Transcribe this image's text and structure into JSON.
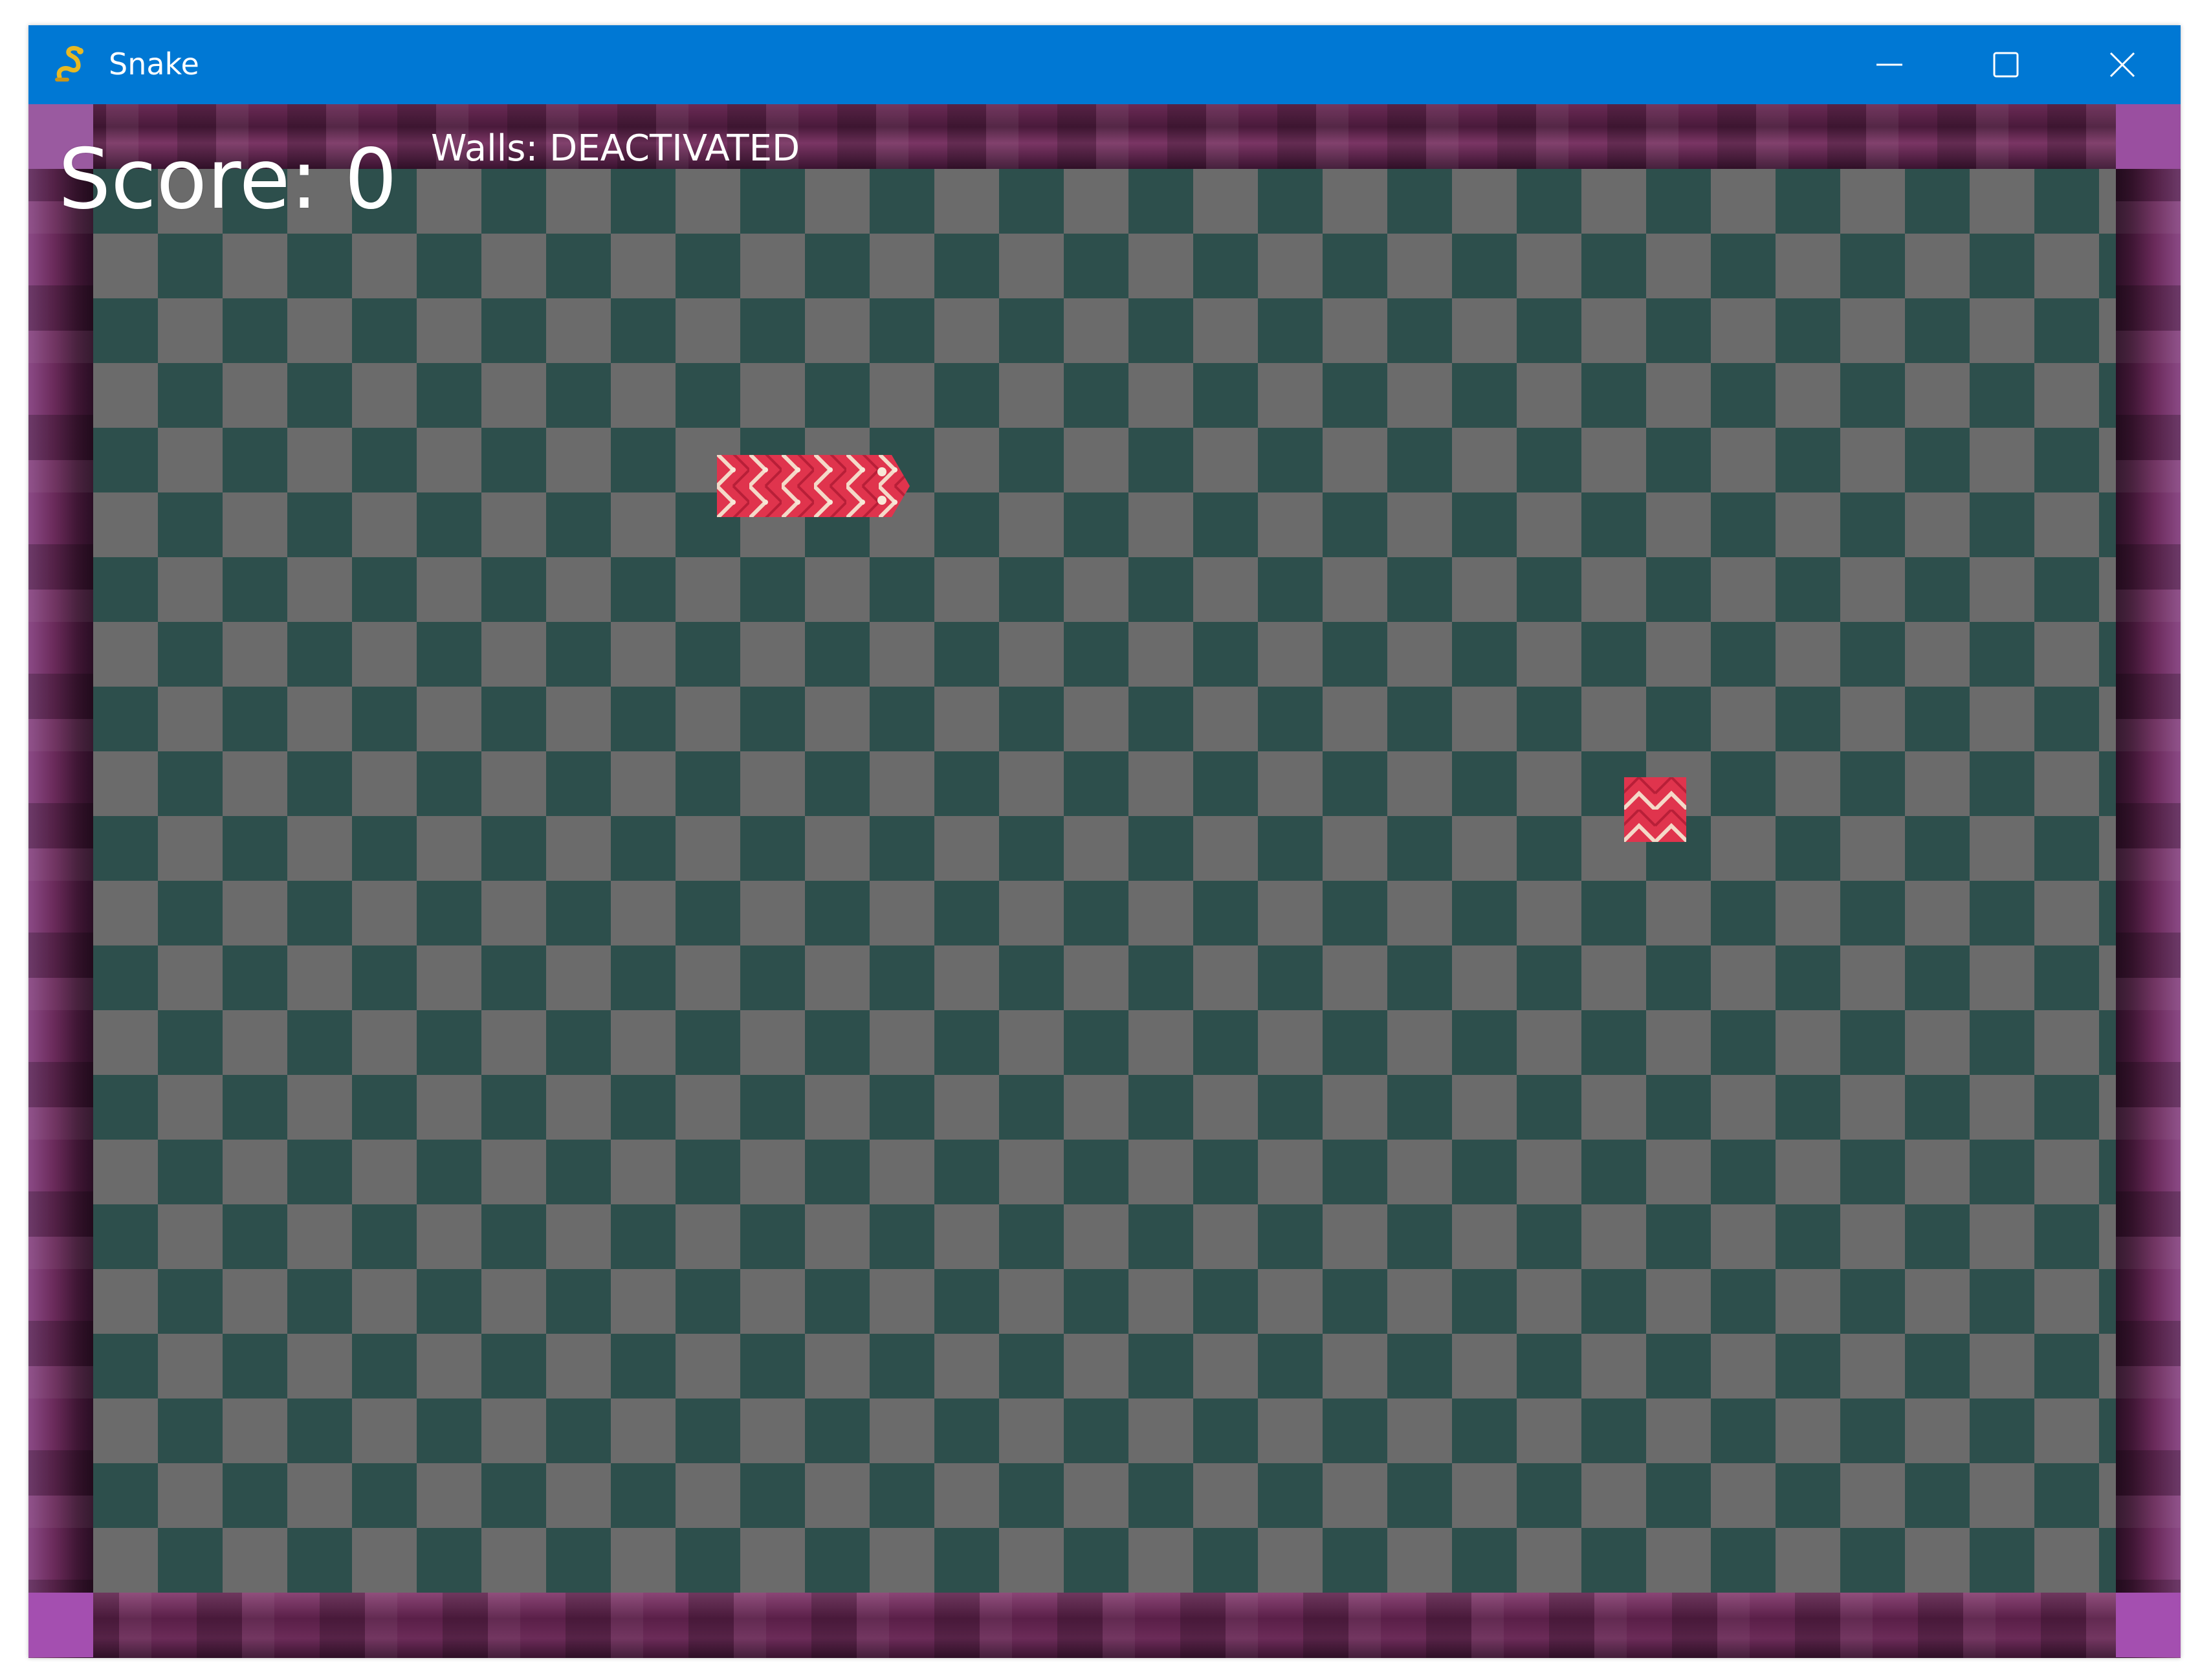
{
  "window": {
    "title": "Snake",
    "icon": "snake-app-icon",
    "controls": [
      "minimize-icon",
      "maximize-icon",
      "close-icon"
    ]
  },
  "hud": {
    "score_label": "Score: 0",
    "walls_status": "Walls: DEACTIVATED"
  },
  "game": {
    "snake_segments": 3,
    "snake_direction": "right",
    "food": "snake-segment-food"
  },
  "colors": {
    "titlebar": "#0078d4",
    "grid_dark": "#2d4f4c",
    "grid_light": "#6b6b6b",
    "border": "#6a2a5a",
    "snake": "#e0344d"
  }
}
